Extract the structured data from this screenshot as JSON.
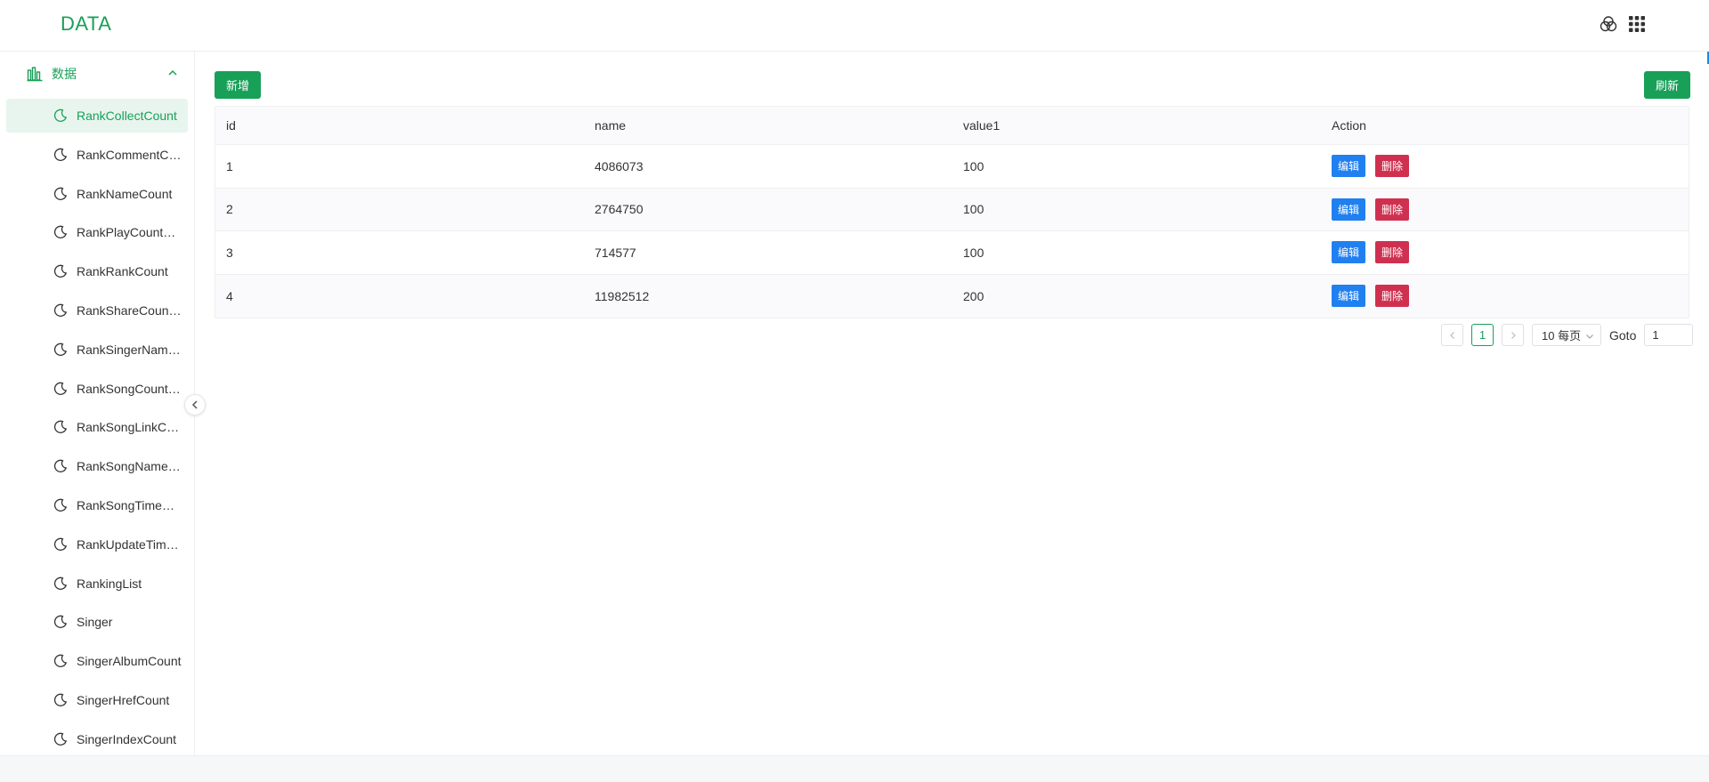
{
  "header": {
    "brand": "DATA",
    "theme_icon": "color-filter-icon",
    "apps_icon": "grid-apps-icon"
  },
  "sidebar": {
    "group_label": "数据",
    "group_icon": "bar-chart-icon",
    "items": [
      {
        "label": "RankCollectCount",
        "active": true
      },
      {
        "label": "RankCommentCount"
      },
      {
        "label": "RankNameCount"
      },
      {
        "label": "RankPlayCountCount"
      },
      {
        "label": "RankRankCount"
      },
      {
        "label": "RankShareCountCount"
      },
      {
        "label": "RankSingerNameCount"
      },
      {
        "label": "RankSongCountCount"
      },
      {
        "label": "RankSongLinkCount"
      },
      {
        "label": "RankSongNameCount"
      },
      {
        "label": "RankSongTimeCount"
      },
      {
        "label": "RankUpdateTimeCount"
      },
      {
        "label": "RankingList"
      },
      {
        "label": "Singer"
      },
      {
        "label": "SingerAlbumCount"
      },
      {
        "label": "SingerHrefCount"
      },
      {
        "label": "SingerIndexCount"
      }
    ]
  },
  "toolbar": {
    "add_label": "新增",
    "refresh_label": "刷新"
  },
  "table": {
    "columns": [
      "id",
      "name",
      "value1",
      "Action"
    ],
    "rows": [
      {
        "id": "1",
        "name": "4086073",
        "value1": "100"
      },
      {
        "id": "2",
        "name": "2764750",
        "value1": "100"
      },
      {
        "id": "3",
        "name": "714577",
        "value1": "100"
      },
      {
        "id": "4",
        "name": "11982512",
        "value1": "200"
      }
    ],
    "edit_label": "编辑",
    "delete_label": "删除"
  },
  "pagination": {
    "current_page": "1",
    "page_size_label": "10 每页",
    "goto_label": "Goto",
    "goto_value": "1"
  },
  "colors": {
    "primary": "#18a058",
    "edit": "#2080f0",
    "delete": "#d03050"
  }
}
